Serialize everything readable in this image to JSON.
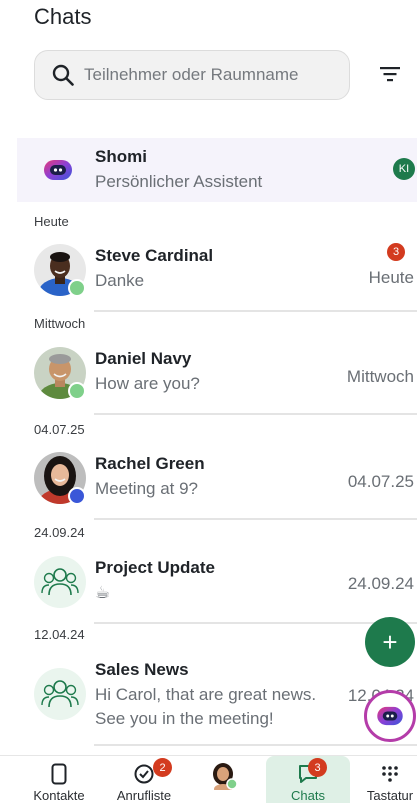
{
  "header": {
    "title": "Chats"
  },
  "search": {
    "placeholder": "Teilnehmer oder Raumname"
  },
  "assistant": {
    "name": "Shomi",
    "subtitle": "Persönlicher Assistent",
    "badge": "KI"
  },
  "sections": [
    "Heute",
    "Mittwoch",
    "04.07.25",
    "24.09.24",
    "12.04.24"
  ],
  "chats": [
    {
      "name": "Steve Cardinal",
      "preview": "Danke",
      "time": "Heute",
      "unread": "3",
      "presence_color": "#7fd08a"
    },
    {
      "name": "Daniel Navy",
      "preview": "How are you?",
      "time": "Mittwoch",
      "presence_color": "#7fd08a"
    },
    {
      "name": "Rachel Green",
      "preview": "Meeting at 9?",
      "time": "04.07.25",
      "presence_color": "#3a57d8"
    },
    {
      "name": "Project Update",
      "preview": "☕",
      "time": "24.09.24"
    },
    {
      "name": "Sales News",
      "preview_line1": "Hi Carol, that are great news.",
      "preview_line2": "See you in the meeting!",
      "time": "12.04.24"
    }
  ],
  "fab": {
    "label": "+"
  },
  "nav": {
    "items": [
      {
        "label": "Kontakte",
        "icon": "phone-icon"
      },
      {
        "label": "Anrufliste",
        "icon": "call-history-icon",
        "badge": "2"
      },
      {
        "label": "",
        "icon": "profile-avatar"
      },
      {
        "label": "Chats",
        "icon": "chat-icon",
        "badge": "3",
        "active": true
      },
      {
        "label": "Tastatur",
        "icon": "dialpad-icon"
      }
    ]
  },
  "colors": {
    "accent": "#1e7a4c",
    "badge": "#d33b1f",
    "assistant_bg": "#f5f3fb",
    "assistant_ring": "#b43ca9"
  }
}
